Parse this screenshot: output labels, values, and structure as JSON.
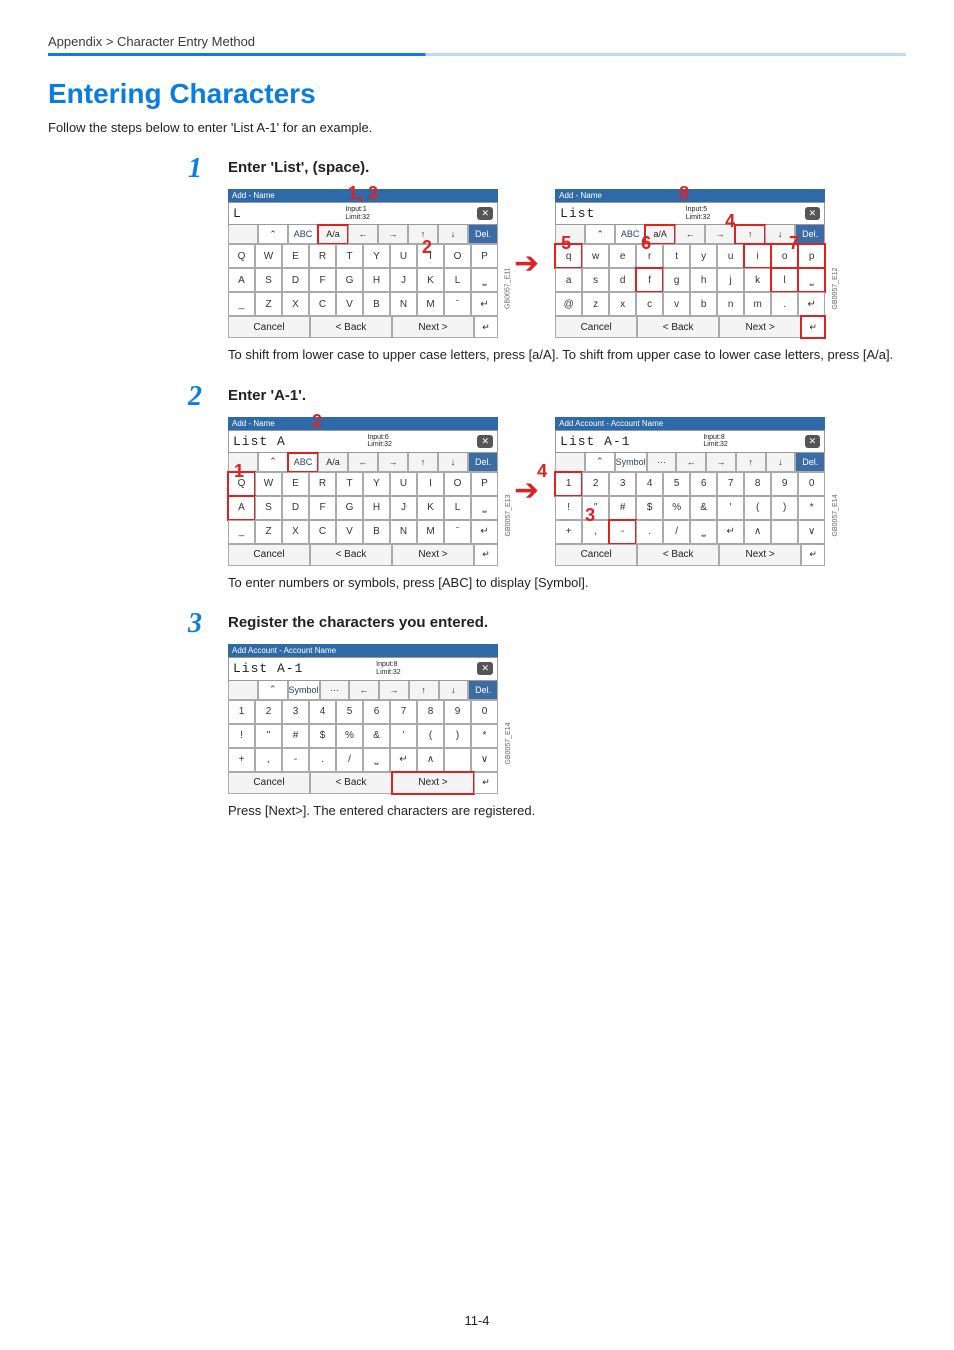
{
  "breadcrumb": "Appendix > Character Entry Method",
  "title": "Entering Characters",
  "intro": "Follow the steps below to enter 'List A-1' for an example.",
  "steps": {
    "s1": {
      "num": "1",
      "text": "Enter 'List', (space)."
    },
    "s2": {
      "num": "2",
      "text": "Enter 'A-1'."
    },
    "s3": {
      "num": "3",
      "text": "Register the characters you entered."
    }
  },
  "notes": {
    "n1": "To shift from lower case to upper case letters, press [a/A]. To shift from upper case to lower case letters, press [A/a].",
    "n2": "To enter numbers or symbols, press [ABC] to display [Symbol].",
    "n3": "Press [Next>]. The entered characters are registered."
  },
  "common": {
    "limit": "Limit:32",
    "abc": "ABC",
    "Aa": "A/a",
    "aA": "a/A",
    "symbol": "Symbol",
    "del": "Del.",
    "cancel": "Cancel",
    "back": "< Back",
    "next": "Next >",
    "close": "✕"
  },
  "panels": {
    "p1": {
      "bar": "Add - Name",
      "display": "L",
      "input": "Input:1",
      "tag": "GB0057_E11"
    },
    "p2": {
      "bar": "Add - Name",
      "display": "List",
      "input": "Input:5",
      "tag": "GB0057_E12"
    },
    "p3": {
      "bar": "Add - Name",
      "display": "List A",
      "input": "Input:6",
      "tag": "GB0057_E13"
    },
    "p4": {
      "bar": "Add Account - Account Name",
      "display": "List A-1",
      "input": "Input:8",
      "tag": "GB0057_E14"
    },
    "p5": {
      "bar": "Add Account - Account Name",
      "display": "List A-1",
      "input": "Input:8",
      "tag": "GB0057_E14"
    }
  },
  "keys": {
    "upper": [
      "Q",
      "W",
      "E",
      "R",
      "T",
      "Y",
      "U",
      "I",
      "O",
      "P",
      "A",
      "S",
      "D",
      "F",
      "G",
      "H",
      "J",
      "K",
      "L",
      "␣",
      "_",
      "Z",
      "X",
      "C",
      "V",
      "B",
      "N",
      "M",
      "ˉ",
      "↵"
    ],
    "lower": [
      "q",
      "w",
      "e",
      "r",
      "t",
      "y",
      "u",
      "i",
      "o",
      "p",
      "a",
      "s",
      "d",
      "f",
      "g",
      "h",
      "j",
      "k",
      "l",
      "␣",
      "@",
      "z",
      "x",
      "c",
      "v",
      "b",
      "n",
      "m",
      ".",
      "↵"
    ],
    "sym": [
      "1",
      "2",
      "3",
      "4",
      "5",
      "6",
      "7",
      "8",
      "9",
      "0",
      "!",
      "\"",
      "#",
      "$",
      "%",
      "&",
      "'",
      "(",
      ")",
      "*",
      "+",
      ",",
      "-",
      ".",
      "/",
      "␣",
      "↵",
      "∧",
      "",
      "∨"
    ]
  },
  "callouts": {
    "c1": "1, 3",
    "c2": "2",
    "c3": "3",
    "c4": "4",
    "c5": "5",
    "c6": "6",
    "c7": "7",
    "c8": "8"
  },
  "page_number": "11-4"
}
